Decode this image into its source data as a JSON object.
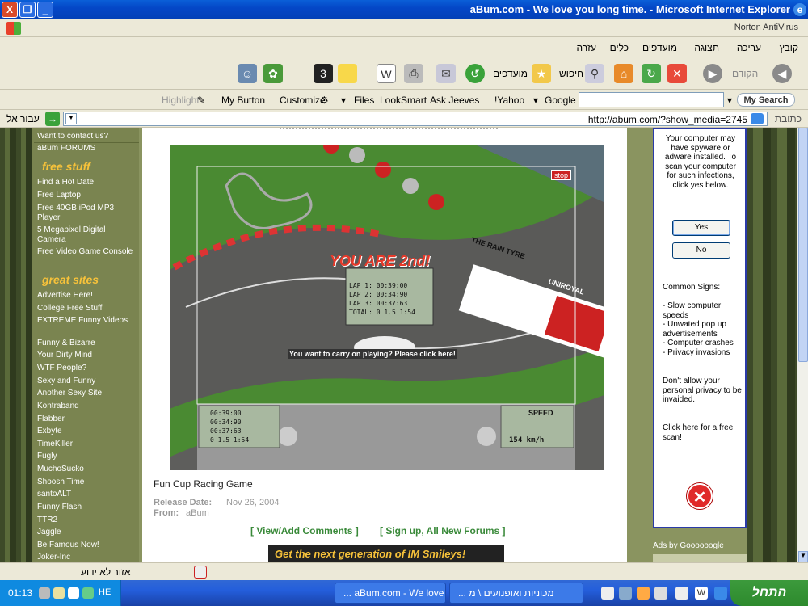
{
  "window": {
    "title": "aBum.com - We love you long time. - Microsoft Internet Explorer",
    "close": "X",
    "restore": "❐",
    "minimize": "_"
  },
  "norton": {
    "label": "Norton AntiVirus"
  },
  "menu": [
    "קובץ",
    "עריכה",
    "תצוגה",
    "מועדפים",
    "כלים",
    "עזרה"
  ],
  "toolbar": {
    "back": "הקודם",
    "search": "חיפוש",
    "favorites": "מועדפים"
  },
  "searchbar": {
    "highlight": "Highlight",
    "my_button": "My Button",
    "customize": "Customize",
    "files": "Files",
    "looksmart": "LookSmart",
    "ask_jeeves": "Ask Jeeves",
    "yahoo": "!Yahoo",
    "google": "Google",
    "mysearch": "My Search"
  },
  "address": {
    "label": "כתובת",
    "url": "http://abum.com/?show_media=2745",
    "go": "עבור אל"
  },
  "sidebar": {
    "top_items": [
      "Want to contact us?",
      "aBum FORUMS"
    ],
    "free_stuff_heading": "free stuff",
    "free_stuff": [
      "Find a Hot Date",
      "Free Laptop",
      "Free 40GB iPod MP3 Player",
      "5 Megapixel Digital Camera",
      "Free Video Game Console"
    ],
    "great_sites_heading": "great sites",
    "great_sites": [
      "Advertise Here!",
      "College Free Stuff",
      "EXTREME Funny Videos",
      "Funny & Bizarre",
      "Your Dirty Mind",
      "WTF People?",
      "Sexy and Funny",
      "Another Sexy Site",
      "Kontraband",
      "Flabber",
      "Exbyte",
      "TimeKiller",
      "Fugly",
      "MuchoSucko",
      "Shoosh Time",
      "santoALT",
      "Funny Flash",
      "TTR2",
      "Jaggle",
      "Be Famous Now!",
      "Joker-Inc"
    ]
  },
  "game": {
    "result": "YOU ARE 2nd!",
    "laps": [
      "LAP 1:  00:39:00",
      "LAP 2:  00:34:90",
      "LAP 3:  00:37:63",
      "TOTAL:  0 1.5 1:54"
    ],
    "prompt": "You want to carry on playing? Please click here!",
    "stop": "stop",
    "times": [
      "00:39:00",
      "00:34:90",
      "00:37:63",
      "0 1.5 1:54"
    ],
    "speed_label": "SPEED",
    "speed_value": "154 km/h",
    "banner_left": "THE RAIN TYRE",
    "banner_right": "UNIROYAL"
  },
  "media": {
    "title": "Fun Cup Racing Game",
    "release_label": "Release Date:",
    "release_value": "Nov 26, 2004",
    "from_label": "From:",
    "from_value": "aBum",
    "comments_link": "[ View/Add Comments ]",
    "signup_link": "[ Sign up, All New Forums ]",
    "banner": "Get the next generation of IM Smileys!"
  },
  "ad": {
    "text1": "Your computer may have spyware or adware installed. To scan your computer for such infections, click yes below.",
    "yes": "Yes",
    "no": "No",
    "common_signs": "Common Signs:",
    "signs": [
      "- Slow computer speeds",
      "- Unwated pop up advertisements",
      "- Computer crashes",
      "- Privacy invasions"
    ],
    "privacy": "Don't allow your personal privacy to be invaided.",
    "click": "Click here for a free scan!",
    "ads_by": "Ads by Goooooogle"
  },
  "status": {
    "zone": "אזור לא ידוע"
  },
  "taskbar": {
    "start": "התחל",
    "task1": "... aBum.com - We love",
    "task2": "... מכוניות ואופנועים \\ מ",
    "clock": "01:13",
    "lang": "HE"
  }
}
